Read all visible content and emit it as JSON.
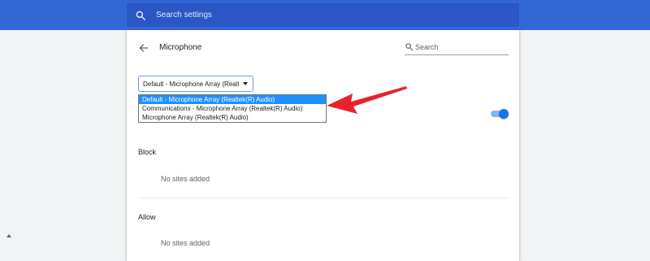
{
  "header": {
    "search_placeholder": "Search settings"
  },
  "page": {
    "title": "Microphone",
    "site_search_placeholder": "Search",
    "select": {
      "selected": "Default - Microphone Array (Realtek(R) Audio)",
      "options": [
        "Default - Microphone Array (Realtek(R) Audio)",
        "Communications - Microphone Array (Realtek(R) Audio)",
        "Microphone Array (Realtek(R) Audio)"
      ]
    },
    "block": {
      "title": "Block",
      "empty": "No sites added"
    },
    "allow": {
      "title": "Allow",
      "empty": "No sites added"
    },
    "ask_toggle": {
      "on": true
    }
  },
  "colors": {
    "header": "#3367d6",
    "header_search": "#2a56c6",
    "selected_option": "#1e90ff",
    "toggle": "#1a73e8",
    "annotation_arrow": "#e8232a"
  },
  "icons": [
    "search-icon",
    "back-arrow-icon",
    "caret-down-icon",
    "scroll-up-icon"
  ]
}
